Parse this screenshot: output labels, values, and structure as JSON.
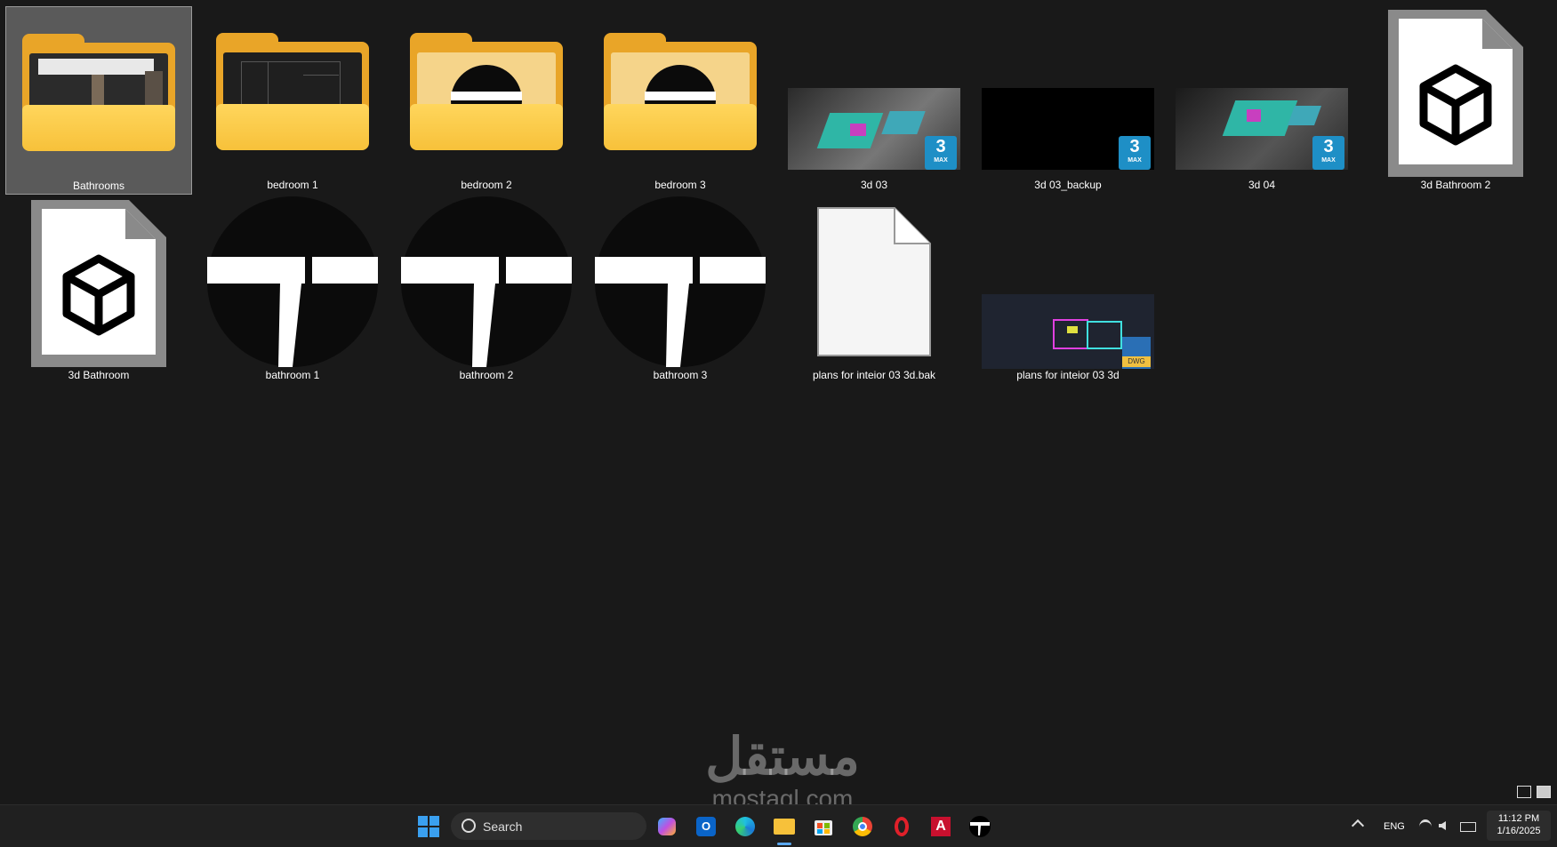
{
  "desktop": {
    "items": [
      {
        "label": "Bathrooms",
        "kind": "folder-photo",
        "selected": true
      },
      {
        "label": "bedroom 1",
        "kind": "folder-plan"
      },
      {
        "label": "bedroom 2",
        "kind": "folder-app"
      },
      {
        "label": "bedroom 3",
        "kind": "folder-app"
      },
      {
        "label": "3d 03",
        "kind": "3dsmax",
        "badge_number": "3",
        "badge_text": "MAX"
      },
      {
        "label": "3d 03_backup",
        "kind": "3dsmax",
        "badge_number": "3",
        "badge_text": "MAX"
      },
      {
        "label": "3d 04",
        "kind": "3dsmax",
        "badge_number": "3",
        "badge_text": "MAX"
      },
      {
        "label": "3d Bathroom 2",
        "kind": "3d-object"
      },
      {
        "label": "3d Bathroom",
        "kind": "3d-object"
      },
      {
        "label": "bathroom 1",
        "kind": "app-shortcut"
      },
      {
        "label": "bathroom 2",
        "kind": "app-shortcut"
      },
      {
        "label": "bathroom 3",
        "kind": "app-shortcut"
      },
      {
        "label": "plans for inteior 03 3d.bak",
        "kind": "blank-file"
      },
      {
        "label": "plans for inteior 03 3d",
        "kind": "dwg",
        "badge_text": "DWG"
      }
    ]
  },
  "taskbar": {
    "search_label": "Search",
    "apps": [
      "windows-start-icon",
      "copilot-icon",
      "outlook-icon",
      "edge-icon",
      "file-explorer-icon",
      "microsoft-store-icon",
      "chrome-icon",
      "opera-icon",
      "autocad-icon",
      "app-t-icon"
    ],
    "tray": {
      "language": "ENG",
      "time": "11:12 PM",
      "date": "1/16/2025"
    }
  },
  "watermark": {
    "arabic": "مستقل",
    "latin": "mostaql.com"
  },
  "colors": {
    "desktop_bg": "#191919",
    "folder_yellow": "#f7c13a",
    "max_blue": "#1e8fc6",
    "taskbar_bg": "#202020"
  }
}
